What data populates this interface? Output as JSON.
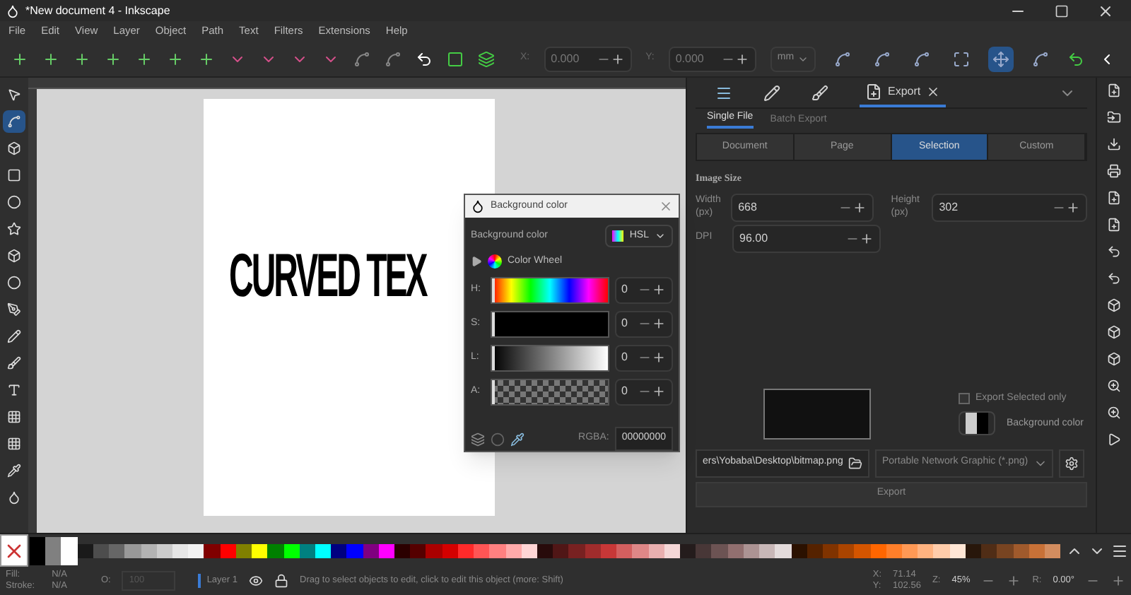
{
  "window": {
    "title": "*New document 4 - Inkscape"
  },
  "menu": [
    "File",
    "Edit",
    "View",
    "Layer",
    "Object",
    "Path",
    "Text",
    "Filters",
    "Extensions",
    "Help"
  ],
  "toolbar": {
    "x_label": "X:",
    "x_value": "0.000",
    "y_label": "Y:",
    "y_value": "0.000",
    "unit": "mm",
    "snap_buttons": [
      {
        "selected": false
      },
      {
        "selected": false
      },
      {
        "selected": false
      },
      {
        "selected": false
      },
      {
        "selected": true
      },
      {
        "selected": false
      }
    ]
  },
  "tools": [
    {
      "selected": false
    },
    {
      "selected": true
    },
    {
      "selected": false
    },
    {
      "selected": false
    },
    {
      "selected": false
    },
    {
      "selected": false
    },
    {
      "selected": false
    },
    {
      "selected": false
    },
    {
      "selected": false
    },
    {
      "selected": false
    },
    {
      "selected": false
    },
    {
      "selected": false
    },
    {
      "selected": false
    },
    {
      "selected": false
    },
    {
      "selected": false
    },
    {
      "selected": false
    }
  ],
  "canvas": {
    "artwork_text": "CURVED TEX"
  },
  "color_dialog": {
    "title": "Background color",
    "label": "Background color",
    "mode": "HSL",
    "wheel_label": "Color Wheel",
    "channels": [
      {
        "label": "H:",
        "value": "0",
        "kind": "hue",
        "level": 0
      },
      {
        "label": "S:",
        "value": "0",
        "kind": "sat",
        "level": 0
      },
      {
        "label": "L:",
        "value": "0",
        "kind": "light",
        "level": 0
      },
      {
        "label": "A:",
        "value": "0",
        "kind": "alpha",
        "level": 0
      }
    ],
    "rgba_label": "RGBA:",
    "rgba_value": "00000000"
  },
  "panel": {
    "tab": "Export",
    "subtabs": [
      {
        "label": "Single File",
        "selected": true
      },
      {
        "label": "Batch Export",
        "selected": false
      }
    ],
    "areas": [
      {
        "label": "Document",
        "selected": false
      },
      {
        "label": "Page",
        "selected": false
      },
      {
        "label": "Selection",
        "selected": true
      },
      {
        "label": "Custom",
        "selected": false
      }
    ],
    "section": "Image Size",
    "width_label": "Width (px)",
    "width_value": "668",
    "height_label": "Height (px)",
    "height_value": "302",
    "dpi_label": "DPI",
    "dpi_value": "96.00",
    "export_selected_only": {
      "label": "Export Selected only",
      "checked": false
    },
    "background_label": "Background color",
    "path": "ers\\Yobaba\\Desktop\\bitmap.png",
    "format": "Portable Network Graphic (*.png)",
    "export_button": "Export"
  },
  "palette": [
    {
      "color": "#000000"
    },
    {
      "color": "#808080"
    },
    {
      "color": "#ffffff"
    },
    {
      "color": "#1a1a1a"
    },
    {
      "color": "#4d4d4d"
    },
    {
      "color": "#666666"
    },
    {
      "color": "#999999"
    },
    {
      "color": "#b3b3b3"
    },
    {
      "color": "#cccccc"
    },
    {
      "color": "#e6e6e6"
    },
    {
      "color": "#f2f2f2"
    },
    {
      "color": "#800000"
    },
    {
      "color": "#ff0000"
    },
    {
      "color": "#808000"
    },
    {
      "color": "#ffff00"
    },
    {
      "color": "#008000"
    },
    {
      "color": "#00ff00"
    },
    {
      "color": "#008080"
    },
    {
      "color": "#00ffff"
    },
    {
      "color": "#000080"
    },
    {
      "color": "#0000ff"
    },
    {
      "color": "#800080"
    },
    {
      "color": "#ff00ff"
    },
    {
      "color": "#2b0000"
    },
    {
      "color": "#550000"
    },
    {
      "color": "#aa0000"
    },
    {
      "color": "#d40000"
    },
    {
      "color": "#ff2a2a"
    },
    {
      "color": "#ff5555"
    },
    {
      "color": "#ff8080"
    },
    {
      "color": "#ffaaaa"
    },
    {
      "color": "#ffd5d5"
    },
    {
      "color": "#280b0b"
    },
    {
      "color": "#501616"
    },
    {
      "color": "#782121"
    },
    {
      "color": "#a02c2c"
    },
    {
      "color": "#c83737"
    },
    {
      "color": "#d35f5f"
    },
    {
      "color": "#de8787"
    },
    {
      "color": "#e9afaf"
    },
    {
      "color": "#f4d7d7"
    },
    {
      "color": "#241c1c"
    },
    {
      "color": "#483737"
    },
    {
      "color": "#6c5353"
    },
    {
      "color": "#916f6f"
    },
    {
      "color": "#ac9393"
    },
    {
      "color": "#c8b7b7"
    },
    {
      "color": "#e3dbdb"
    },
    {
      "color": "#2b1100"
    },
    {
      "color": "#552200"
    },
    {
      "color": "#803300"
    },
    {
      "color": "#aa4400"
    },
    {
      "color": "#d45500"
    },
    {
      "color": "#ff6600"
    },
    {
      "color": "#ff7f2a"
    },
    {
      "color": "#ff9955"
    },
    {
      "color": "#ffb380"
    },
    {
      "color": "#ffccaa"
    },
    {
      "color": "#ffe6d5"
    },
    {
      "color": "#28170b"
    },
    {
      "color": "#502d16"
    },
    {
      "color": "#784421"
    },
    {
      "color": "#a05a2c"
    },
    {
      "color": "#c87137"
    },
    {
      "color": "#d38d5f"
    }
  ],
  "status": {
    "fill_label": "Fill:",
    "fill_value": "N/A",
    "stroke_label": "Stroke:",
    "stroke_value": "N/A",
    "opacity_label": "O:",
    "opacity_value": "100",
    "layer": "Layer 1",
    "message": "Drag to select objects to edit, click to edit this object (more: Shift)",
    "x_label": "X:",
    "x_value": "71.14",
    "y_label": "Y:",
    "y_value": "102.56",
    "zoom_label": "Z:",
    "zoom_value": "45%",
    "rotate_label": "R:",
    "rotate_value": "0.00°"
  }
}
